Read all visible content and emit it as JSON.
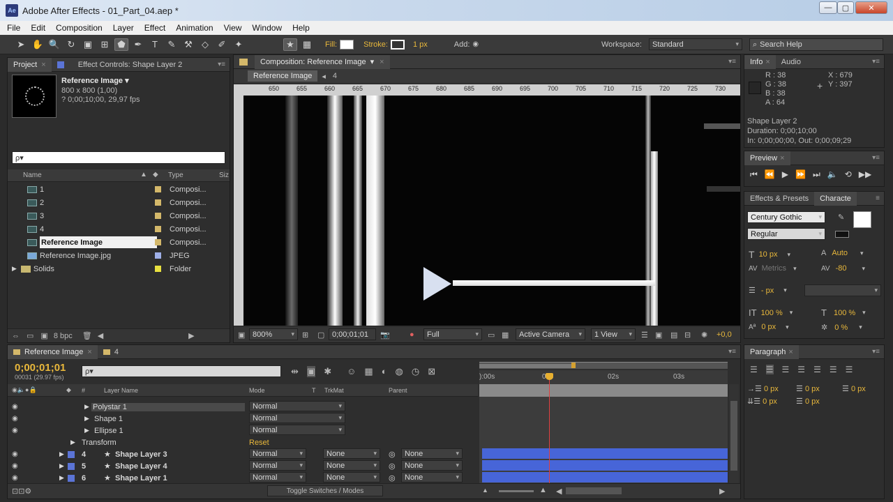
{
  "window": {
    "title": "Adobe After Effects - 01_Part_04.aep *",
    "app_icon": "Ae",
    "min": "—",
    "max": "▢",
    "close": "✕"
  },
  "menu": [
    "File",
    "Edit",
    "Composition",
    "Layer",
    "Effect",
    "Animation",
    "View",
    "Window",
    "Help"
  ],
  "toolbar": {
    "fill_label": "Fill:",
    "stroke_label": "Stroke:",
    "stroke_width": "1 px",
    "add_label": "Add:",
    "workspace_label": "Workspace:",
    "workspace_value": "Standard",
    "search_help": "Search Help"
  },
  "project": {
    "tab_project": "Project",
    "tab_effect_controls": "Effect Controls: Shape Layer 2",
    "selected_name": "Reference Image ▾",
    "selected_dims": "800 x 800 (1,00)",
    "selected_duration": "? 0;00;10;00, 29,97 fps",
    "search_placeholder": "ρ▾",
    "col_name": "Name",
    "col_type": "Type",
    "col_size": "Siz",
    "items": [
      {
        "name": "1",
        "type": "Composi..."
      },
      {
        "name": "2",
        "type": "Composi..."
      },
      {
        "name": "3",
        "type": "Composi..."
      },
      {
        "name": "4",
        "type": "Composi..."
      },
      {
        "name": "Reference Image",
        "type": "Composi..."
      },
      {
        "name": "Reference Image.jpg",
        "type": "JPEG"
      },
      {
        "name": "Solids",
        "type": "Folder"
      }
    ],
    "bpc": "8 bpc"
  },
  "composition": {
    "tab": "Composition: Reference Image",
    "crumb_active": "Reference Image",
    "crumb_other": "4",
    "ruler": [
      "650",
      "655",
      "660",
      "665",
      "670",
      "675",
      "680",
      "685",
      "690",
      "695",
      "700",
      "705",
      "710",
      "715",
      "720",
      "725",
      "730"
    ],
    "zoom": "800%",
    "timecode": "0;00;01;01",
    "resolution": "Full",
    "camera": "Active Camera",
    "views": "1 View",
    "exposure": "+0,0"
  },
  "info": {
    "tab_info": "Info",
    "tab_audio": "Audio",
    "r": "R : 38",
    "g": "G : 38",
    "b": "B : 38",
    "a": "A : 64",
    "x": "X : 679",
    "y": "Y : 397",
    "layer": "Shape Layer 2",
    "duration": "Duration: 0;00;10;00",
    "inout": "In: 0;00;00;00, Out: 0;00;09;29"
  },
  "preview": {
    "tab": "Preview"
  },
  "character": {
    "tab_effects": "Effects & Presets",
    "tab_character": "Characte",
    "font": "Century Gothic",
    "style": "Regular",
    "size": "10 px",
    "leading": "Auto",
    "kerning": "Metrics",
    "tracking": "-80",
    "stroke_w": "- px",
    "vscale": "100 %",
    "hscale": "100 %",
    "baseline": "0 px",
    "tsume": "0 %"
  },
  "paragraph": {
    "tab": "Paragraph",
    "v1": "0 px",
    "v2": "0 px",
    "v3": "0 px",
    "v4": "0 px",
    "v5": "0 px"
  },
  "timeline": {
    "tab_active": "Reference Image",
    "tab_other": "4",
    "timecode": "0;00;01;01",
    "frame_info": "00031 (29.97 fps)",
    "search_placeholder": "ρ▾",
    "col_hash": "#",
    "col_layer_name": "Layer Name",
    "col_mode": "Mode",
    "col_t": "T",
    "col_trkmat": "TrkMat",
    "col_parent": "Parent",
    "ruler": [
      "):00s",
      "01s",
      "02s",
      "03s"
    ],
    "sub_rows": [
      {
        "name": "Polystar 1",
        "mode": "Normal"
      },
      {
        "name": "Shape 1",
        "mode": "Normal"
      },
      {
        "name": "Ellipse 1",
        "mode": "Normal"
      }
    ],
    "transform": "Transform",
    "reset": "Reset",
    "layers": [
      {
        "num": "4",
        "name": "Shape Layer 3",
        "mode": "Normal",
        "trkmat": "None",
        "parent": "None"
      },
      {
        "num": "5",
        "name": "Shape Layer 4",
        "mode": "Normal",
        "trkmat": "None",
        "parent": "None"
      },
      {
        "num": "6",
        "name": "Shape Layer 1",
        "mode": "Normal",
        "trkmat": "None",
        "parent": "None"
      }
    ],
    "toggle": "Toggle Switches / Modes"
  }
}
